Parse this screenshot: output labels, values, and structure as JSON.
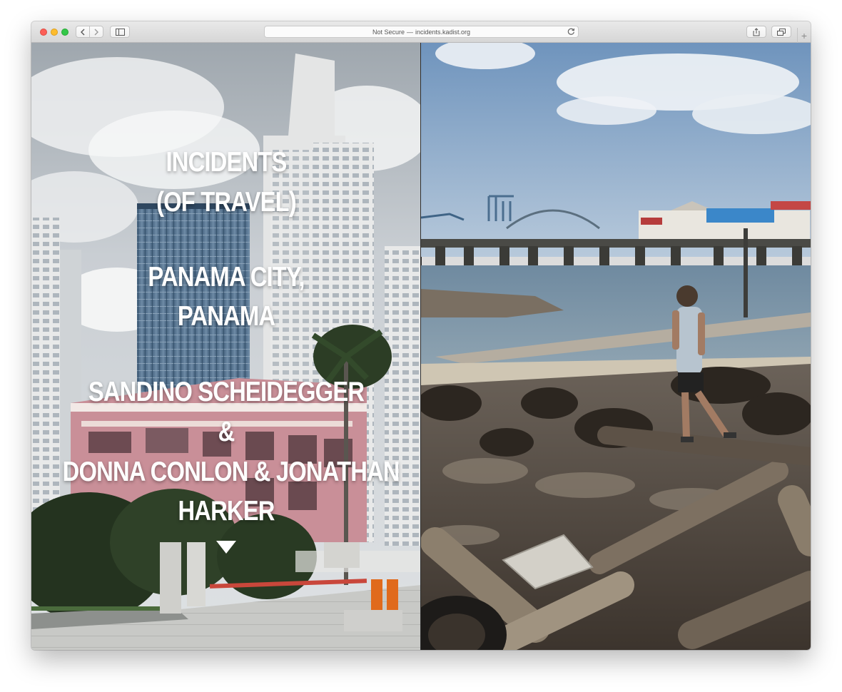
{
  "browser": {
    "address": {
      "security": "Not Secure",
      "separator": "—",
      "url": "incidents.kadist.org"
    },
    "icons": {
      "back": "chevron-left-icon",
      "forward": "chevron-right-icon",
      "sidebar": "sidebar-icon",
      "reload": "reload-icon",
      "share": "share-icon",
      "tabs": "tabs-overview-icon",
      "new_tab": "plus-icon"
    },
    "new_tab_label": "+"
  },
  "hero": {
    "title_line1": "INCIDENTS",
    "title_line2": "(OF TRAVEL)",
    "location_line1": "PANAMA CITY,",
    "location_line2": "PANAMA",
    "artist_line1": "SANDINO SCHEIDEGGER",
    "ampersand": "&",
    "artist_line2": "DONNA CONLON & JONATHAN",
    "artist_line3": "HARKER",
    "scroll_icon": "triangle-down-icon",
    "text_color": "#ffffff"
  },
  "images": {
    "left": "photo-panama-city-towers-street",
    "right": "photo-man-walking-on-driftwood-shore"
  },
  "colors": {
    "close": "#fc5f57",
    "minimize": "#fdbc2e",
    "zoom": "#33c748",
    "barrier_orange": "#e06a1c"
  }
}
